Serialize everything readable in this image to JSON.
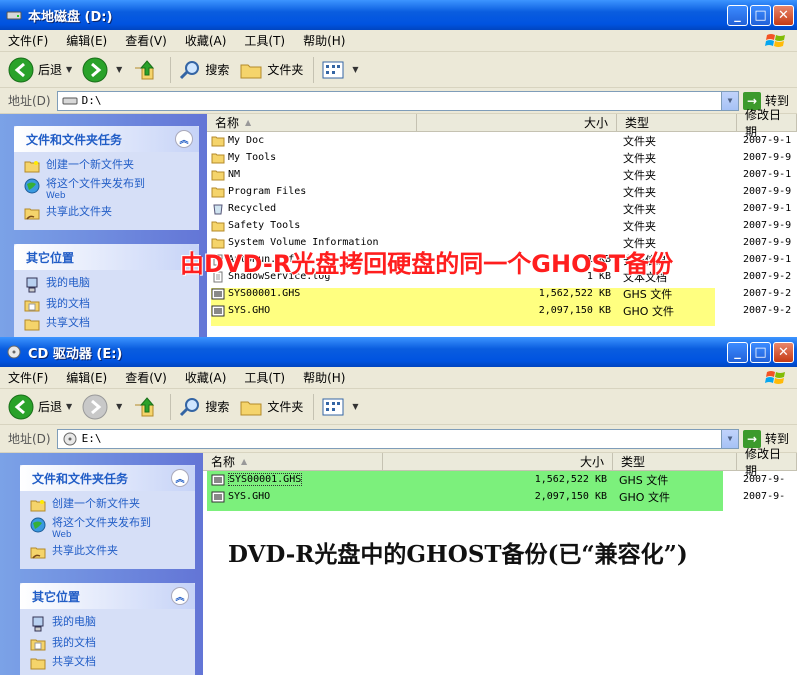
{
  "window1": {
    "title": "本地磁盘 (D:)",
    "menu": [
      "文件(F)",
      "编辑(E)",
      "查看(V)",
      "收藏(A)",
      "工具(T)",
      "帮助(H)"
    ],
    "toolbar": {
      "back": "后退",
      "search": "搜索",
      "folders": "文件夹"
    },
    "address_label": "地址(D)",
    "address": "D:\\",
    "go": "转到",
    "columns": {
      "name": "名称",
      "size": "大小",
      "type": "类型",
      "date": "修改日期"
    },
    "task_panel": {
      "title": "文件和文件夹任务",
      "items": [
        "创建一个新文件夹",
        "将这个文件夹发布到",
        "共享此文件夹"
      ],
      "item_sub": "Web"
    },
    "places_panel": {
      "title": "其它位置",
      "items": [
        "我的电脑",
        "我的文档",
        "共享文档"
      ]
    },
    "files": [
      {
        "name": "My Doc",
        "size": "",
        "type": "文件夹",
        "date": "2007-9-1"
      },
      {
        "name": "My Tools",
        "size": "",
        "type": "文件夹",
        "date": "2007-9-9"
      },
      {
        "name": "NM",
        "size": "",
        "type": "文件夹",
        "date": "2007-9-1"
      },
      {
        "name": "Program Files",
        "size": "",
        "type": "文件夹",
        "date": "2007-9-9"
      },
      {
        "name": "Recycled",
        "size": "",
        "type": "文件夹",
        "date": "2007-9-1"
      },
      {
        "name": "Safety Tools",
        "size": "",
        "type": "文件夹",
        "date": "2007-9-9"
      },
      {
        "name": "System Volume Information",
        "size": "",
        "type": "文件夹",
        "date": "2007-9-9"
      },
      {
        "name": "AutoRun.inf",
        "size": "1 KB",
        "type": "安装信息",
        "date": "2007-9-1"
      },
      {
        "name": "ShadowService.log",
        "size": "1 KB",
        "type": "文本文档",
        "date": "2007-9-2"
      },
      {
        "name": "SYS00001.GHS",
        "size": "1,562,522 KB",
        "type": "GHS 文件",
        "date": "2007-9-2"
      },
      {
        "name": "SYS.GHO",
        "size": "2,097,150 KB",
        "type": "GHO 文件",
        "date": "2007-9-2"
      }
    ],
    "caption": "由DVD-R光盘拷回硬盘的同一个GHOST备份"
  },
  "window2": {
    "title": "CD 驱动器 (E:)",
    "menu": [
      "文件(F)",
      "编辑(E)",
      "查看(V)",
      "收藏(A)",
      "工具(T)",
      "帮助(H)"
    ],
    "toolbar": {
      "back": "后退",
      "search": "搜索",
      "folders": "文件夹"
    },
    "address_label": "地址(D)",
    "address": "E:\\",
    "go": "转到",
    "columns": {
      "name": "名称",
      "size": "大小",
      "type": "类型",
      "date": "修改日期"
    },
    "task_panel": {
      "title": "文件和文件夹任务",
      "items": [
        "创建一个新文件夹",
        "将这个文件夹发布到",
        "共享此文件夹"
      ],
      "item_sub": "Web"
    },
    "places_panel": {
      "title": "其它位置",
      "items": [
        "我的电脑",
        "我的文档",
        "共享文档"
      ]
    },
    "files": [
      {
        "name": "SYS00001.GHS",
        "size": "1,562,522 KB",
        "type": "GHS 文件",
        "date": "2007-9-"
      },
      {
        "name": "SYS.GHO",
        "size": "2,097,150 KB",
        "type": "GHO 文件",
        "date": "2007-9-"
      }
    ],
    "caption": "DVD-R光盘中的GHOST备份(已“兼容化”)"
  },
  "colors": {
    "highlight_yellow": "#ffff80",
    "highlight_green": "#7cf07c",
    "caption_red": "#ff1e1e",
    "caption_black": "#111111",
    "link_blue": "#215dc6"
  },
  "icons": [
    "drive-icon",
    "cd-drive-icon",
    "folder-icon",
    "file-icon",
    "ghost-file-icon",
    "back-icon",
    "forward-icon",
    "up-icon",
    "search-icon",
    "folders-icon",
    "views-icon",
    "computer-icon",
    "documents-icon",
    "shared-folder-icon",
    "windows-logo-icon"
  ]
}
